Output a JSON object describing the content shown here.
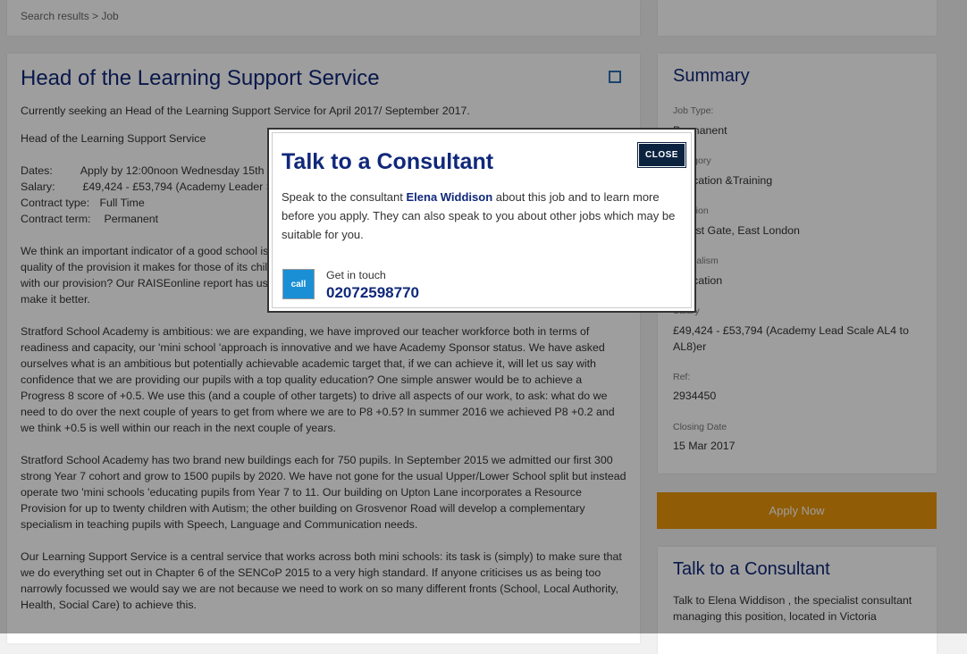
{
  "breadcrumb": "Search results > Job",
  "job": {
    "title": "Head of the Learning Support Service",
    "intro": "Currently seeking an Head of the Learning Support Service for April 2017/ September 2017.",
    "subtitle": "Head of the Learning Support Service",
    "details": [
      {
        "label": "Dates:",
        "value": "Apply by 12:00noon Wednesday 15th March 2017"
      },
      {
        "label": "Salary:",
        "value": "£49,424 - £53,794 (Academy Leader Scale AL4 to AL8)"
      },
      {
        "label": "Contract type:",
        "value": "Full Time"
      },
      {
        "label": "Contract term:",
        "value": "Permanent"
      }
    ],
    "paragraphs": [
      "We think an important indicator of a good school is how effectively it provides for all of its pupils with high potential. Is the quality of the provision it makes for those of its children with special educational needs. How does the school do compare with our provision? Our RAISEonline report has us a long way to go to achieve our aspirations, for we are determined to make it better.",
      "Stratford School Academy is ambitious: we are expanding, we have improved our teacher workforce both in terms of readiness and capacity, our 'mini school 'approach is innovative and we have Academy Sponsor status. We have asked ourselves what is an ambitious but potentially achievable academic target that, if we can achieve it, will let us say with confidence that we are providing our pupils with a top quality education? One simple answer would be to achieve a Progress 8 score of +0.5. We use this (and a couple of other targets) to drive all aspects of our work, to ask: what do we need to do over the next couple of years to get from where we are to P8 +0.5? In summer 2016 we achieved P8 +0.2 and we think +0.5 is well within our reach in the next couple of years.",
      "Stratford School Academy has two brand new buildings each for 750 pupils. In September 2015 we admitted our first 300 strong Year 7 cohort and grow to 1500 pupils by 2020. We have not gone for the usual Upper/Lower School split but instead operate two 'mini schools 'educating pupils from Year 7 to 11. Our building on Upton Lane incorporates a Resource Provision for up to twenty children with Autism; the other building on Grosvenor Road will develop a complementary specialism in teaching pupils with Speech, Language and Communication needs.",
      "Our Learning Support Service is a central service that works across both mini schools: its task is (simply) to make sure that we do everything set out in Chapter 6 of the SENCoP 2015 to a very high standard. If anyone criticises us as being too narrowly focussed we would say we are not because we need to work on so many different fronts (School, Local Authority, Health, Social Care) to achieve this."
    ]
  },
  "summary": {
    "title": "Summary",
    "fields": [
      {
        "label": "Job Type:",
        "value": "Permanent"
      },
      {
        "label": "Category",
        "value": "Education &Training"
      },
      {
        "label": "Location",
        "value": "Forest Gate, East London"
      },
      {
        "label": "Specialism",
        "value": "Education"
      },
      {
        "label": "Salary",
        "value": "£49,424 - £53,794 (Academy Lead Scale AL4 to AL8)er"
      },
      {
        "label": "Ref:",
        "value": "2934450"
      },
      {
        "label": "Closing Date",
        "value": "15 Mar 2017"
      }
    ],
    "apply_label": "Apply Now"
  },
  "consultant_card": {
    "title": "Talk to a Consultant",
    "text": "Talk to Elena Widdison , the specialist consultant managing this position, located in Victoria"
  },
  "modal": {
    "title": "Talk to a Consultant",
    "close_label": "CLOSE",
    "text_before": "Speak to the consultant ",
    "consultant_name": "Elena Widdison",
    "text_after": " about this job and to learn more before you apply. They can also speak to you about other jobs which may be suitable for you.",
    "call_icon_alt": "call",
    "get_in_touch": "Get in touch",
    "phone": "02072598770"
  },
  "colors": {
    "navy": "#10287a",
    "apply": "#e8950a",
    "close_bg": "#0c2340"
  }
}
